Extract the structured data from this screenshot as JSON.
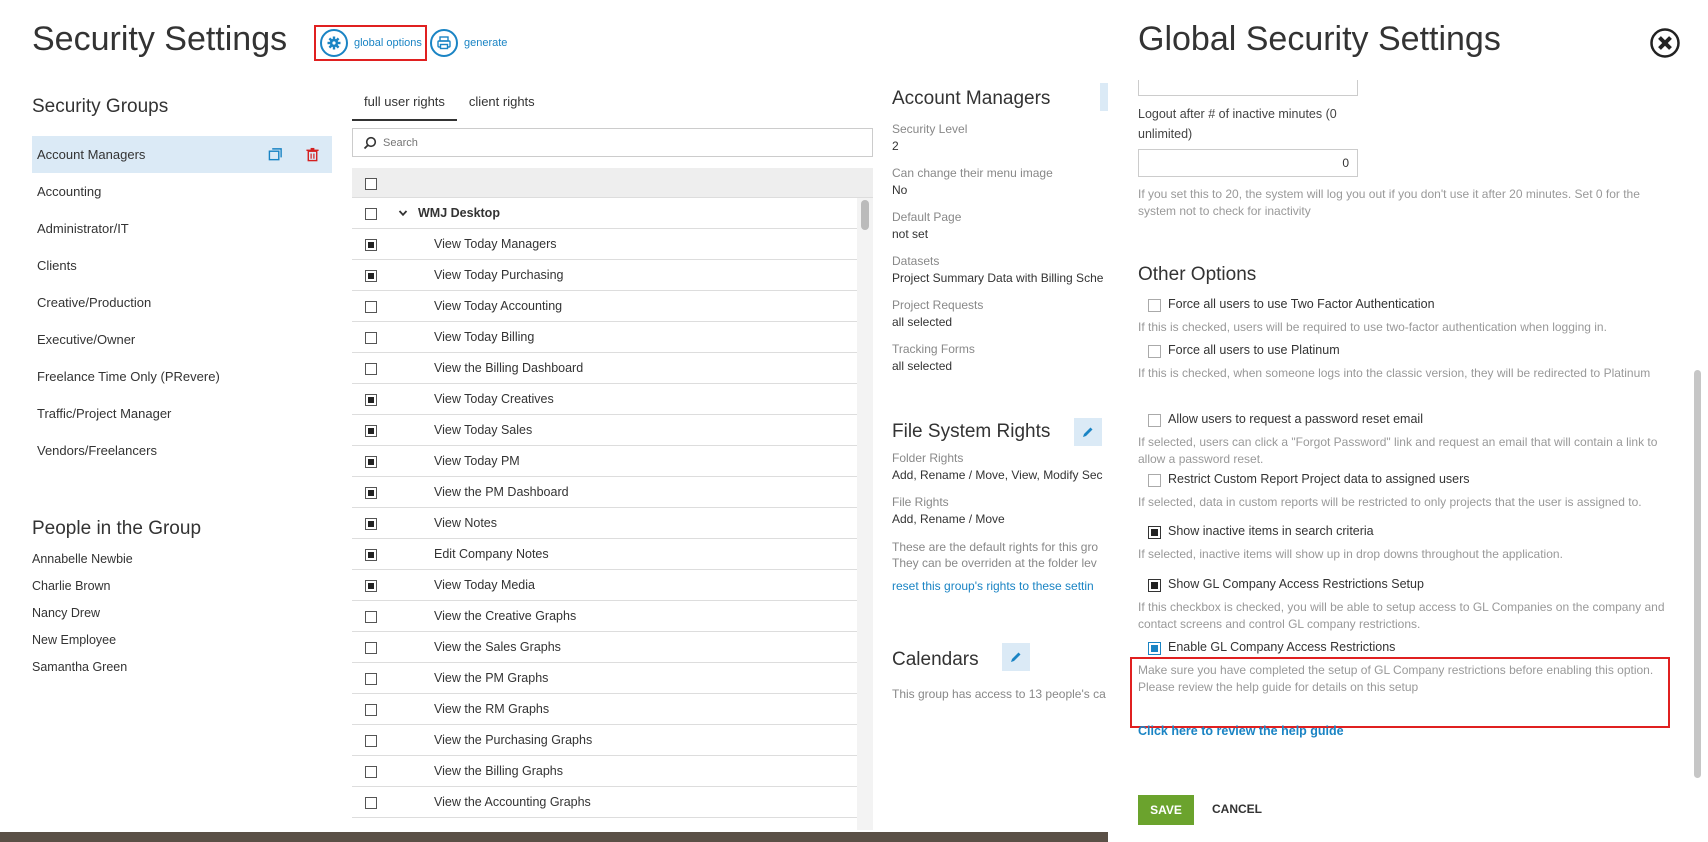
{
  "main": {
    "title": "Security Settings",
    "header_links": {
      "global_options": "global options",
      "generate": "generate"
    }
  },
  "groups": {
    "title": "Security Groups",
    "items": [
      "Account Managers",
      "Accounting",
      "Administrator/IT",
      "Clients",
      "Creative/Production",
      "Executive/Owner",
      "Freelance Time Only (PRevere)",
      "Traffic/Project Manager",
      "Vendors/Freelancers"
    ],
    "selected": "Account Managers"
  },
  "people": {
    "title": "People in the Group",
    "items": [
      "Annabelle Newbie",
      "Charlie Brown",
      "Nancy Drew",
      "New Employee",
      "Samantha Green"
    ]
  },
  "rights": {
    "tabs": [
      "full user rights",
      "client rights"
    ],
    "active_tab": "full user rights",
    "search_placeholder": "Search",
    "group_label": "WMJ Desktop",
    "rows": [
      {
        "label": "View Today Managers",
        "checked": true
      },
      {
        "label": "View Today Purchasing",
        "checked": true
      },
      {
        "label": "View Today Accounting",
        "checked": false
      },
      {
        "label": "View Today Billing",
        "checked": false
      },
      {
        "label": "View the Billing Dashboard",
        "checked": false
      },
      {
        "label": "View Today Creatives",
        "checked": true
      },
      {
        "label": "View Today Sales",
        "checked": true
      },
      {
        "label": "View Today PM",
        "checked": true
      },
      {
        "label": "View the PM Dashboard",
        "checked": true
      },
      {
        "label": "View Notes",
        "checked": true
      },
      {
        "label": "Edit Company Notes",
        "checked": true
      },
      {
        "label": "View Today Media",
        "checked": true
      },
      {
        "label": "View the Creative Graphs",
        "checked": false
      },
      {
        "label": "View the Sales Graphs",
        "checked": false
      },
      {
        "label": "View the PM Graphs",
        "checked": false
      },
      {
        "label": "View the RM Graphs",
        "checked": false
      },
      {
        "label": "View the Purchasing Graphs",
        "checked": false
      },
      {
        "label": "View the Billing Graphs",
        "checked": false
      },
      {
        "label": "View the Accounting Graphs",
        "checked": false
      }
    ]
  },
  "detail": {
    "title": "Account Managers",
    "security_level_label": "Security Level",
    "security_level_value": "2",
    "menu_image_label": "Can change their menu image",
    "menu_image_value": "No",
    "default_page_label": "Default Page",
    "default_page_value": "not set",
    "datasets_label": "Datasets",
    "datasets_value": "Project Summary Data with Billing Sche",
    "project_requests_label": "Project Requests",
    "project_requests_value": "all selected",
    "tracking_forms_label": "Tracking Forms",
    "tracking_forms_value": "all selected",
    "fs_title": "File System Rights",
    "folder_rights_label": "Folder Rights",
    "folder_rights_value": "Add, Rename / Move, View, Modify Sec",
    "file_rights_label": "File Rights",
    "file_rights_value": "Add, Rename / Move",
    "fs_note_1": "These are the default rights for this gro",
    "fs_note_2": "They can be overriden at the folder lev",
    "fs_reset_link": "reset this group's rights to these settin",
    "cal_title": "Calendars",
    "cal_note": "This group has access to 13 people's ca"
  },
  "panel": {
    "title": "Global Security Settings",
    "logout_label": "Logout after # of inactive minutes (0 unlimited)",
    "logout_value": "0",
    "logout_help": "If you set this to 20, the system will log you out if you don't use it after 20 minutes. Set 0 for the system not to check for inactivity",
    "other_title": "Other Options",
    "options": [
      {
        "label": "Force all users to use Two Factor Authentication",
        "help": "If this is checked, users will be required to use two-factor authentication when logging in.",
        "state": "unchecked"
      },
      {
        "label": "Force all users to use Platinum",
        "help": "If this is checked, when someone logs into the classic version, they will be redirected to Platinum",
        "state": "unchecked"
      },
      {
        "label": "Allow users to request a password reset email",
        "help": "If selected, users can click a \"Forgot Password\" link and request an email that will contain a link to allow a password reset.",
        "state": "unchecked"
      },
      {
        "label": "Restrict Custom Report Project data to assigned users",
        "help": "If selected, data in custom reports will be restricted to only projects that the user is assigned to.",
        "state": "unchecked"
      },
      {
        "label": "Show inactive items in search criteria",
        "help": "If selected, inactive items will show up in drop downs throughout the application.",
        "state": "checked"
      },
      {
        "label": "Show GL Company Access Restrictions Setup",
        "help": "If this checkbox is checked, you will be able to setup access to GL Companies on the company and contact screens and control GL company restrictions.",
        "state": "checked"
      },
      {
        "label": "Enable GL Company Access Restrictions",
        "help": "Make sure you have completed the setup of GL Company restrictions before enabling this option. Please review the help guide for details on this setup",
        "state": "focused"
      }
    ],
    "help_link": "Click here to review the help guide",
    "save_label": "SAVE",
    "cancel_label": "CANCEL"
  },
  "colors": {
    "accent": "#1a84c4",
    "save": "#6ba32d",
    "highlight": "#e02020",
    "selected_row": "#dbeaf6"
  }
}
